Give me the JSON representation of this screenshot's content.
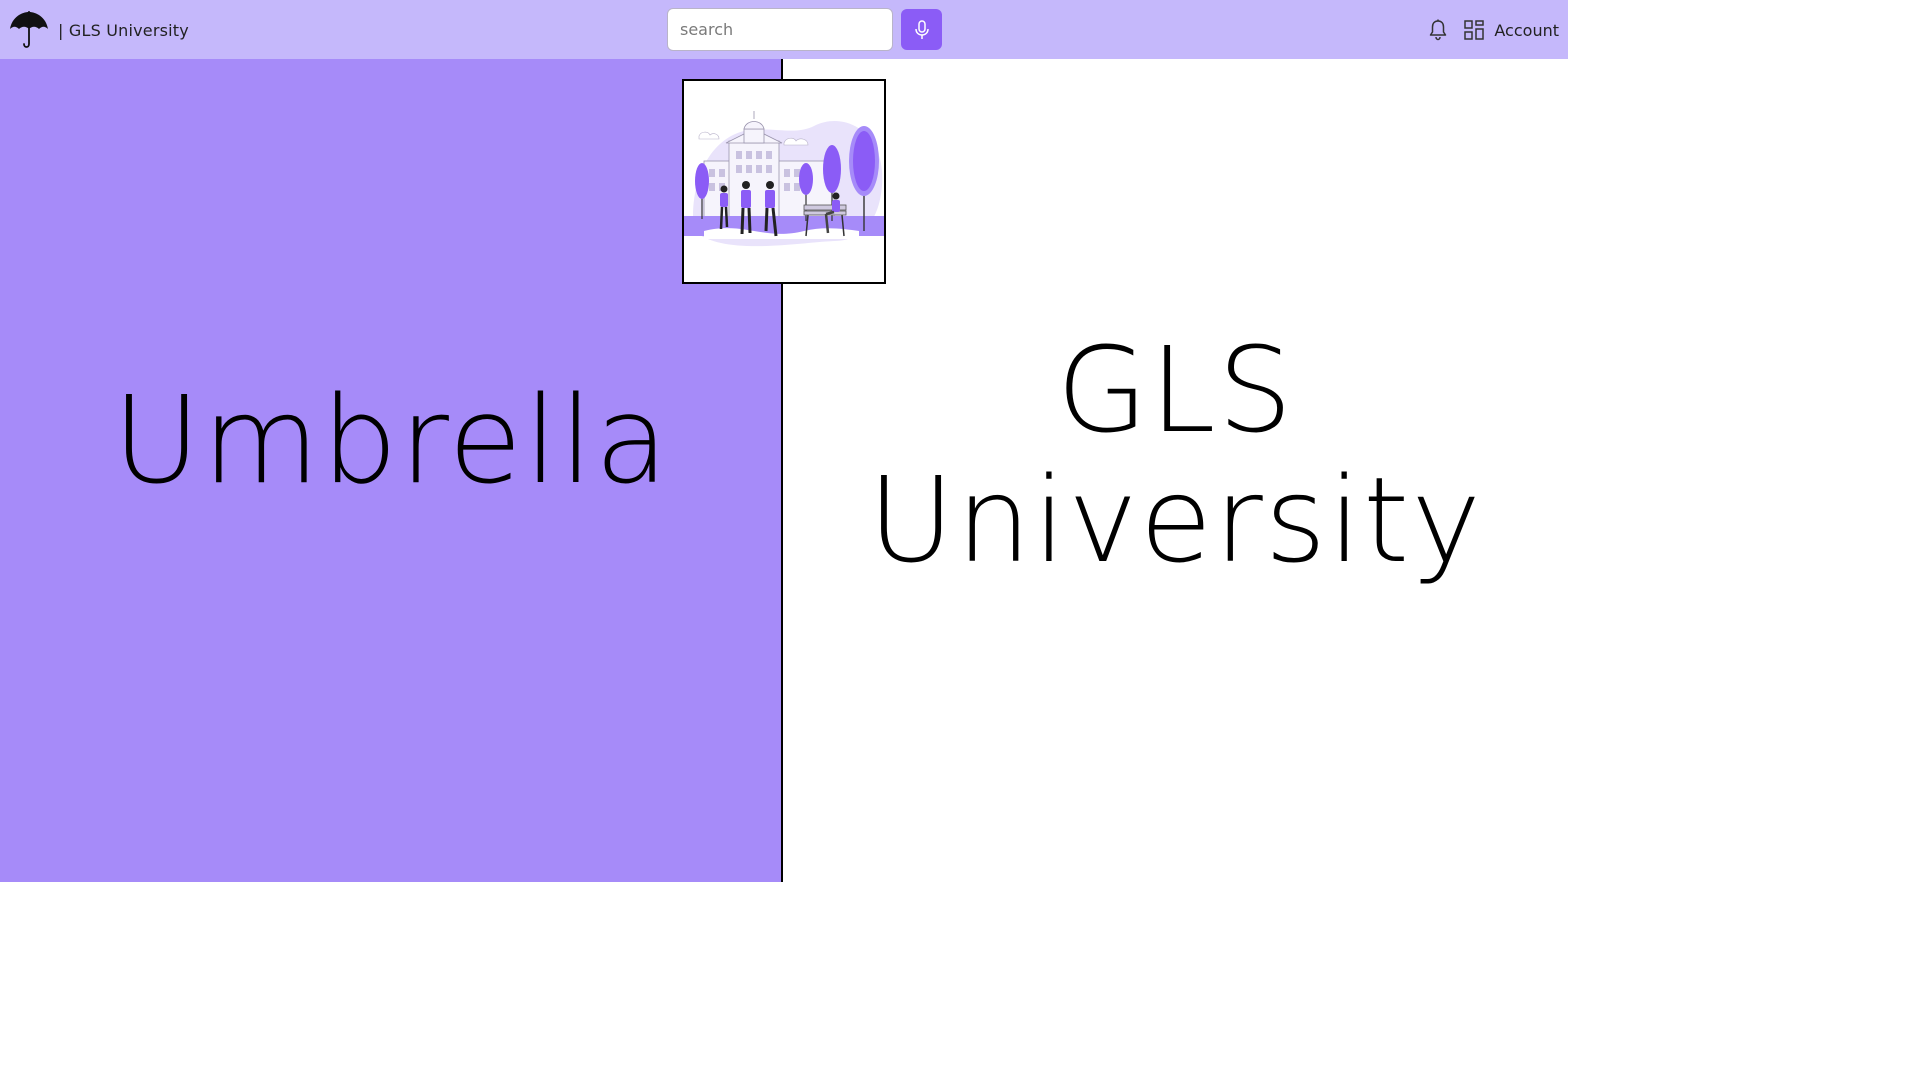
{
  "navbar": {
    "brand_text": "| GLS University",
    "search_placeholder": "search",
    "mic_icon": "microphone-icon",
    "bell_icon": "bell-icon",
    "apps_icon": "apps-grid-icon",
    "account_label": "Account"
  },
  "hero": {
    "left_title": "Umbrella",
    "right_title_line1": "GLS",
    "right_title_line2": "University"
  },
  "colors": {
    "navbar_bg": "#c5b8fb",
    "left_panel_bg": "#a68bf9",
    "accent": "#8b5cf6"
  }
}
